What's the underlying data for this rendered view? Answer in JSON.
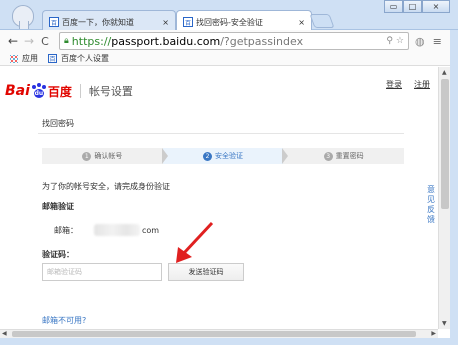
{
  "browser": {
    "tabs": [
      {
        "title": "百度一下，你就知道",
        "favicon": "百",
        "active": false
      },
      {
        "title": "找回密码-安全验证",
        "favicon": "百",
        "active": true
      }
    ],
    "close_glyph": "×",
    "window_buttons": {
      "minimize": "▭",
      "maximize": "□",
      "close": "×"
    },
    "url": {
      "scheme": "https://",
      "host": "passport.baidu.com",
      "path": "/?getpassindex"
    },
    "bookmarks": {
      "apps": "应用",
      "item": "百度个人设置"
    }
  },
  "page": {
    "top_links": {
      "login": "登录",
      "register": "注册"
    },
    "logo": {
      "bai": "Bai",
      "du": "du",
      "cn": "百度"
    },
    "header_title": "帐号设置",
    "section_title": "找回密码",
    "steps": [
      {
        "num": "1",
        "label": "确认帐号"
      },
      {
        "num": "2",
        "label": "安全验证"
      },
      {
        "num": "3",
        "label": "重置密码"
      }
    ],
    "intro": "为了你的帐号安全，请完成身份验证",
    "email_section": "邮箱验证",
    "email_label": "邮箱：",
    "email_suffix": "com",
    "code_label": "验证码：",
    "code_placeholder": "邮箱验证码",
    "send_button": "发送验证码",
    "feedback": "意见反馈",
    "unavailable_link": "邮箱不可用?"
  },
  "colors": {
    "accent": "#3a77c4",
    "logo_red": "#e10601",
    "logo_blue": "#2932e1",
    "annotation_arrow": "#e02020"
  }
}
